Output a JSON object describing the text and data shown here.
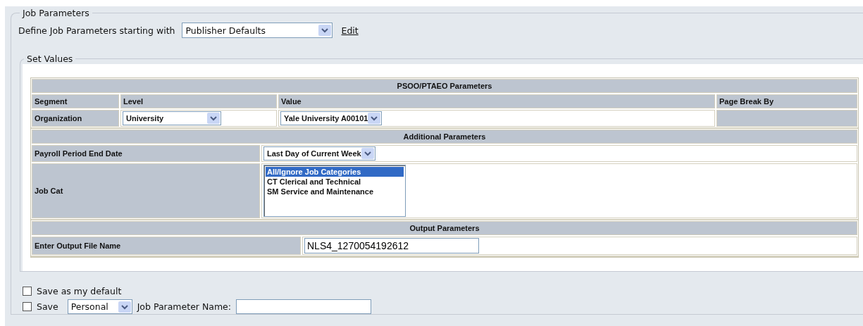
{
  "job_parameters": {
    "legend": "Job Parameters",
    "define_label": "Define Job Parameters starting with",
    "define_select": {
      "value": "Publisher Defaults"
    },
    "edit_link": "Edit"
  },
  "set_values": {
    "legend": "Set Values",
    "psoo": {
      "title": "PSOO/PTAEO Parameters",
      "columns": [
        "Segment",
        "Level",
        "Value",
        "Page Break By"
      ],
      "row": {
        "segment": "Organization",
        "level": "University",
        "value": "Yale University A00101"
      }
    },
    "additional": {
      "title": "Additional Parameters",
      "payroll": {
        "label": "Payroll Period End Date",
        "value": "Last Day of Current Week"
      },
      "job_cat": {
        "label": "Job Cat",
        "options": [
          {
            "label": "All/Ignore Job Categories",
            "selected": true
          },
          {
            "label": "CT Clerical and Technical",
            "selected": false
          },
          {
            "label": "SM Service and Maintenance",
            "selected": false
          }
        ]
      }
    },
    "output": {
      "title": "Output Parameters",
      "label": "Enter Output File Name",
      "value": "NLS4_1270054192612"
    }
  },
  "save_default": {
    "label": "Save as my default",
    "checked": false
  },
  "save": {
    "label": "Save",
    "checked": false,
    "scope": "Personal",
    "name_label": "Job Parameter Name:"
  }
}
